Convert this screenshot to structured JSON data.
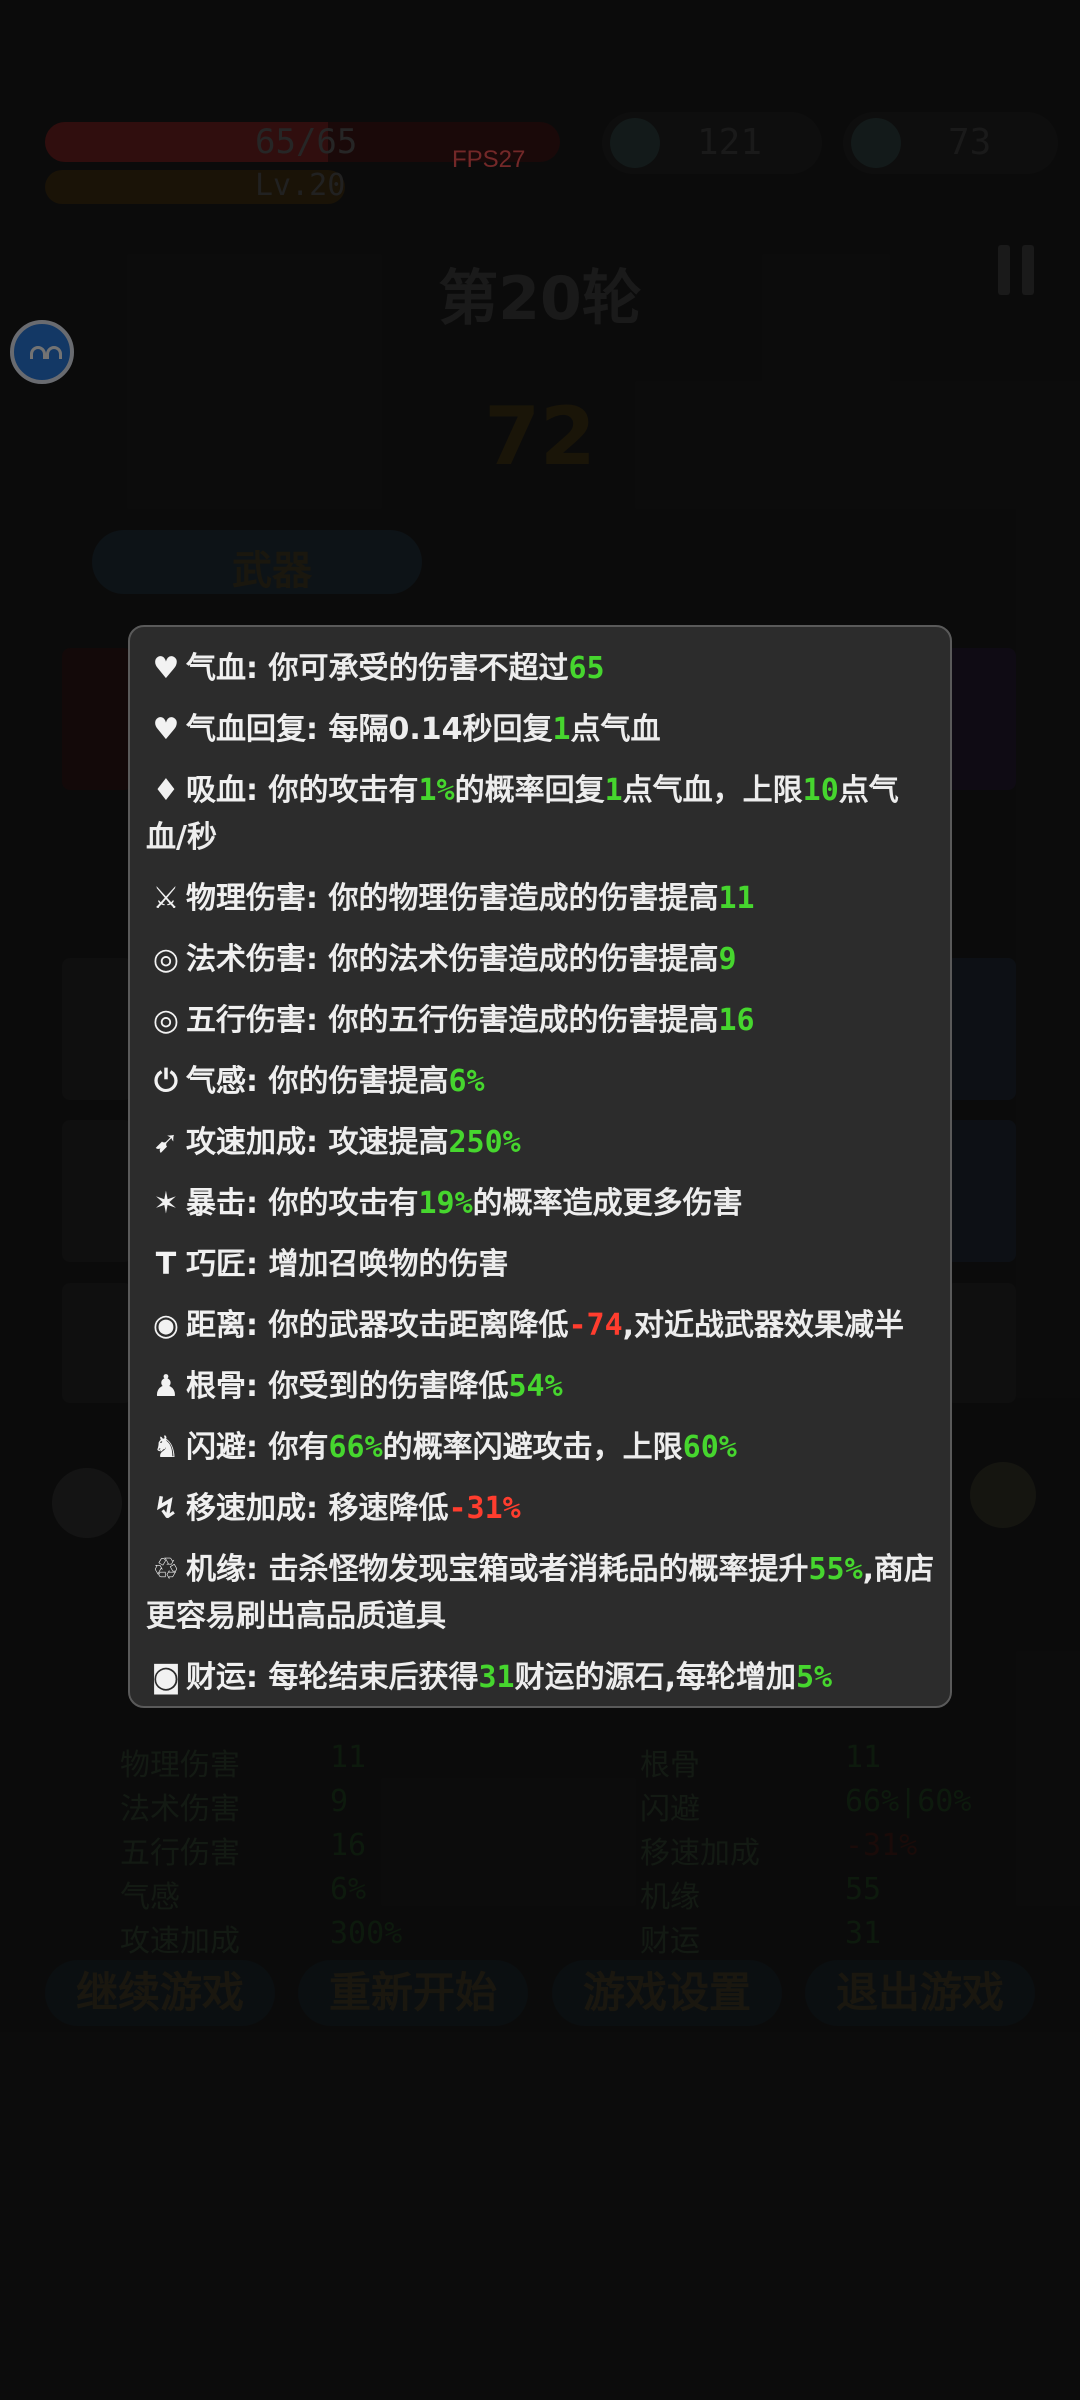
{
  "hud": {
    "hp_text": "65/65",
    "level_text": "Lv.20",
    "fps": "FPS27",
    "resource1": "121",
    "resource2": "73"
  },
  "round_title": "第20轮",
  "timer": "72",
  "weapon_tab": "武器",
  "bottom_buttons": [
    "继续游戏",
    "重新开始",
    "游戏设置",
    "退出游戏"
  ],
  "bg_stats_left": [
    {
      "icon": "sword-icon",
      "name": "物理伤害",
      "value": "11"
    },
    {
      "icon": "spiral-icon",
      "name": "法术伤害",
      "value": "9"
    },
    {
      "icon": "target-icon",
      "name": "五行伤害",
      "value": "16"
    },
    {
      "icon": "power-icon",
      "name": "气感",
      "value": "6%"
    },
    {
      "icon": "speed-icon",
      "name": "攻速加成",
      "value": "300%"
    }
  ],
  "bg_stats_right": [
    {
      "icon": "figure-icon",
      "name": "根骨",
      "value": "11"
    },
    {
      "icon": "dodge-icon",
      "name": "闪避",
      "value": "66%|60%"
    },
    {
      "icon": "boot-icon",
      "name": "移速加成",
      "value": "-31%"
    },
    {
      "icon": "luck-icon",
      "name": "机缘",
      "value": "55"
    },
    {
      "icon": "coin-icon",
      "name": "财运",
      "value": "31"
    }
  ],
  "tooltip": {
    "rows": [
      {
        "icon": "♥",
        "name": "气血",
        "segments": [
          [
            "你可承受的伤害不超过",
            ""
          ],
          [
            "65",
            "g"
          ]
        ]
      },
      {
        "icon": "♥",
        "name": "气血回复",
        "segments": [
          [
            "每隔0.14秒回复",
            ""
          ],
          [
            "1",
            "g"
          ],
          [
            "点气血",
            ""
          ]
        ]
      },
      {
        "icon": "♦",
        "name": "吸血",
        "segments": [
          [
            "你的攻击有",
            ""
          ],
          [
            "1%",
            "g"
          ],
          [
            "的概率回复",
            ""
          ],
          [
            "1",
            "g"
          ],
          [
            "点气血，上限",
            ""
          ],
          [
            "10",
            "g"
          ],
          [
            "点气血/秒",
            ""
          ]
        ]
      },
      {
        "icon": "⚔",
        "name": "物理伤害",
        "segments": [
          [
            "你的物理伤害造成的伤害提高",
            ""
          ],
          [
            "11",
            "g"
          ]
        ]
      },
      {
        "icon": "◎",
        "name": "法术伤害",
        "segments": [
          [
            "你的法术伤害造成的伤害提高",
            ""
          ],
          [
            "9",
            "g"
          ]
        ]
      },
      {
        "icon": "◎",
        "name": "五行伤害",
        "segments": [
          [
            "你的五行伤害造成的伤害提高",
            ""
          ],
          [
            "16",
            "g"
          ]
        ]
      },
      {
        "icon": "⏻",
        "name": "气感",
        "segments": [
          [
            "你的伤害提高",
            ""
          ],
          [
            "6%",
            "g"
          ]
        ]
      },
      {
        "icon": "➹",
        "name": "攻速加成",
        "segments": [
          [
            "攻速提高",
            ""
          ],
          [
            "250%",
            "g"
          ]
        ]
      },
      {
        "icon": "✶",
        "name": "暴击",
        "segments": [
          [
            "你的攻击有",
            ""
          ],
          [
            "19%",
            "g"
          ],
          [
            "的概率造成更多伤害",
            ""
          ]
        ]
      },
      {
        "icon": "T",
        "name": "巧匠",
        "segments": [
          [
            "增加召唤物的伤害",
            ""
          ]
        ]
      },
      {
        "icon": "◉",
        "name": "距离",
        "segments": [
          [
            "你的武器攻击距离降低",
            ""
          ],
          [
            "-74",
            "r"
          ],
          [
            ",对近战武器效果减半",
            ""
          ]
        ]
      },
      {
        "icon": "♟",
        "name": "根骨",
        "segments": [
          [
            "你受到的伤害降低",
            ""
          ],
          [
            "54%",
            "g"
          ]
        ]
      },
      {
        "icon": "♞",
        "name": "闪避",
        "segments": [
          [
            "你有",
            ""
          ],
          [
            "66%",
            "g"
          ],
          [
            "的概率闪避攻击，上限",
            ""
          ],
          [
            "60%",
            "g"
          ]
        ]
      },
      {
        "icon": "↯",
        "name": "移速加成",
        "segments": [
          [
            "移速降低",
            ""
          ],
          [
            "-31%",
            "r"
          ]
        ]
      },
      {
        "icon": "♲",
        "name": "机缘",
        "segments": [
          [
            "击杀怪物发现宝箱或者消耗品的概率提升",
            ""
          ],
          [
            "55%",
            "g"
          ],
          [
            ",商店更容易刷出高品质道具",
            ""
          ]
        ]
      },
      {
        "icon": "◙",
        "name": "财运",
        "segments": [
          [
            "每轮结束后获得",
            ""
          ],
          [
            "31",
            "g"
          ],
          [
            "财运的源石,每轮增加",
            ""
          ],
          [
            "5%",
            "g"
          ]
        ]
      }
    ]
  }
}
